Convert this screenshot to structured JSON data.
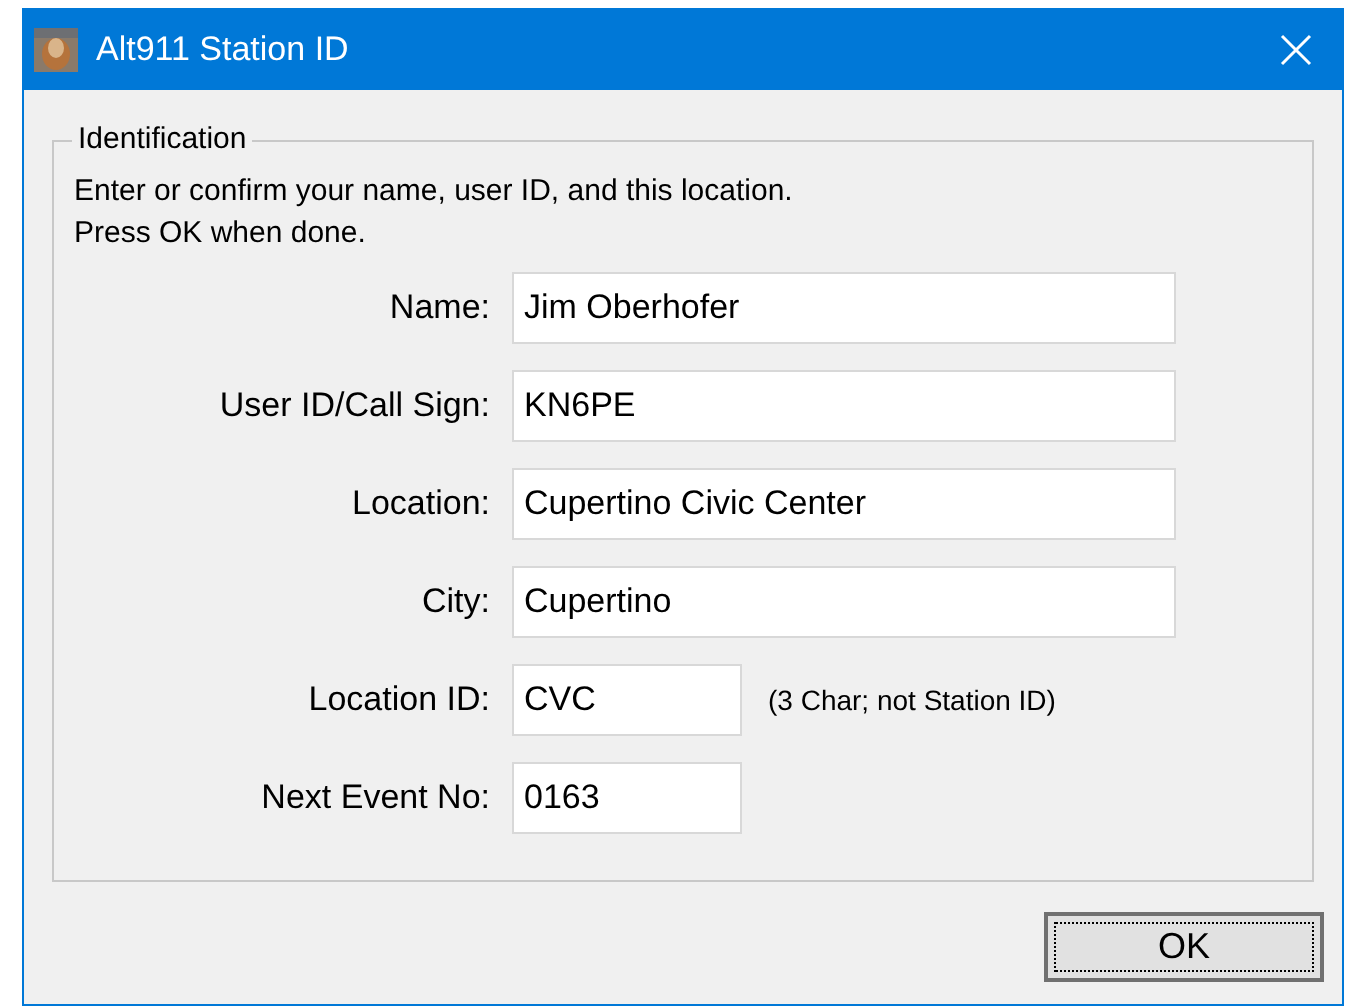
{
  "window": {
    "title": "Alt911 Station ID"
  },
  "group": {
    "title": "Identification",
    "instructions": [
      "Enter or confirm your name, user ID, and this location.",
      "Press OK when done."
    ]
  },
  "fields": [
    {
      "label": "Name:",
      "value": "Jim Oberhofer",
      "kind": "wide"
    },
    {
      "label": "User ID/Call Sign:",
      "value": "KN6PE",
      "kind": "wide"
    },
    {
      "label": "Location:",
      "value": "Cupertino Civic Center",
      "kind": "wide"
    },
    {
      "label": "City:",
      "value": "Cupertino",
      "kind": "wide"
    },
    {
      "label": "Location ID:",
      "value": "CVC",
      "kind": "short",
      "note": "(3 Char; not Station ID)"
    },
    {
      "label": "Next Event No:",
      "value": "0163",
      "kind": "short"
    }
  ],
  "buttons": [
    "OK"
  ]
}
